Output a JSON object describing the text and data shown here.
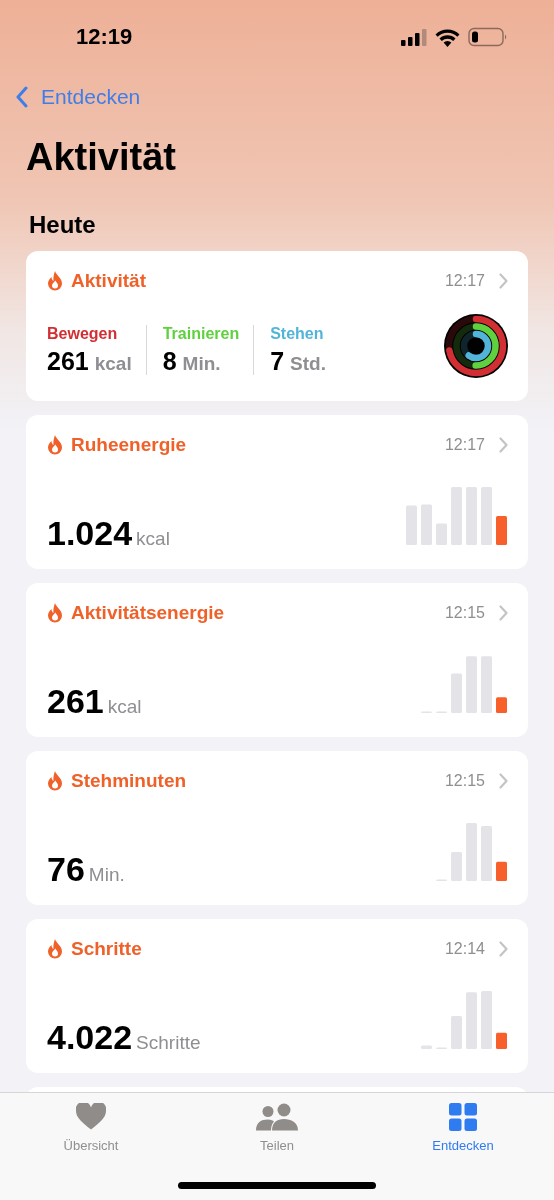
{
  "status_bar": {
    "time": "12:19"
  },
  "nav": {
    "back": "Entdecken"
  },
  "title": "Aktivität",
  "section": "Heute",
  "activity_card": {
    "title": "Aktivität",
    "time": "12:17",
    "metrics": [
      {
        "label": "Bewegen",
        "value": "261",
        "unit": "kcal",
        "color": "#d22f34"
      },
      {
        "label": "Trainieren",
        "value": "8",
        "unit": "Min.",
        "color": "#5fd13f"
      },
      {
        "label": "Stehen",
        "value": "7",
        "unit": "Std.",
        "color": "#52b4d9"
      }
    ]
  },
  "cards": [
    {
      "title": "Ruheenergie",
      "time": "12:17",
      "value": "1.024",
      "unit": "kcal"
    },
    {
      "title": "Aktivitätsenergie",
      "time": "12:15",
      "value": "261",
      "unit": "kcal"
    },
    {
      "title": "Stehminuten",
      "time": "12:15",
      "value": "76",
      "unit": "Min."
    },
    {
      "title": "Schritte",
      "time": "12:14",
      "value": "4.022",
      "unit": "Schritte"
    }
  ],
  "tab_bar": [
    {
      "kind": "summary",
      "label": "Übersicht",
      "selected": false
    },
    {
      "kind": "sharing",
      "label": "Teilen",
      "selected": false
    },
    {
      "kind": "browse",
      "label": "Entdecken",
      "selected": true
    }
  ]
}
